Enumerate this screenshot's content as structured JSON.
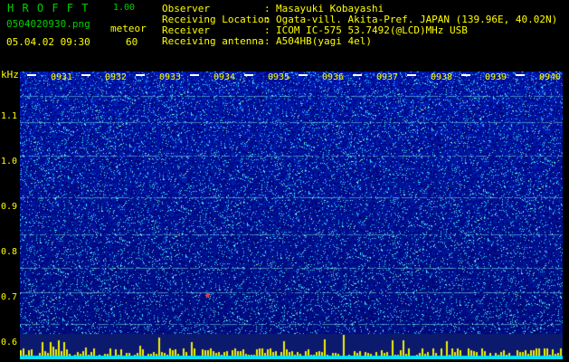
{
  "header": {
    "app_name": "H R O F F T",
    "version": "1.00",
    "file_name": "0504020930.png",
    "mode_label": "meteor",
    "datetime": "05.04.02 09:30",
    "count": "60"
  },
  "info": [
    {
      "key": "Observer",
      "value": "Masayuki Kobayashi"
    },
    {
      "key": "Receiving Location",
      "value": "Ogata-vill. Akita-Pref. JAPAN (139.96E, 40.02N)"
    },
    {
      "key": "Receiver",
      "value": "ICOM IC-575 53.7492(@LCD)MHz USB"
    },
    {
      "key": "Receiving antenna",
      "value": "A504HB(yagi 4el)"
    }
  ],
  "spectrogram": {
    "y_unit": "kHz",
    "y_ticks": [
      "1.1",
      "1.0",
      "0.9",
      "0.8",
      "0.7",
      "0.6"
    ],
    "time_ticks": [
      "0931",
      "0932",
      "0933",
      "0934",
      "0935",
      "0936",
      "0937",
      "0938",
      "0939",
      "0940"
    ]
  }
}
